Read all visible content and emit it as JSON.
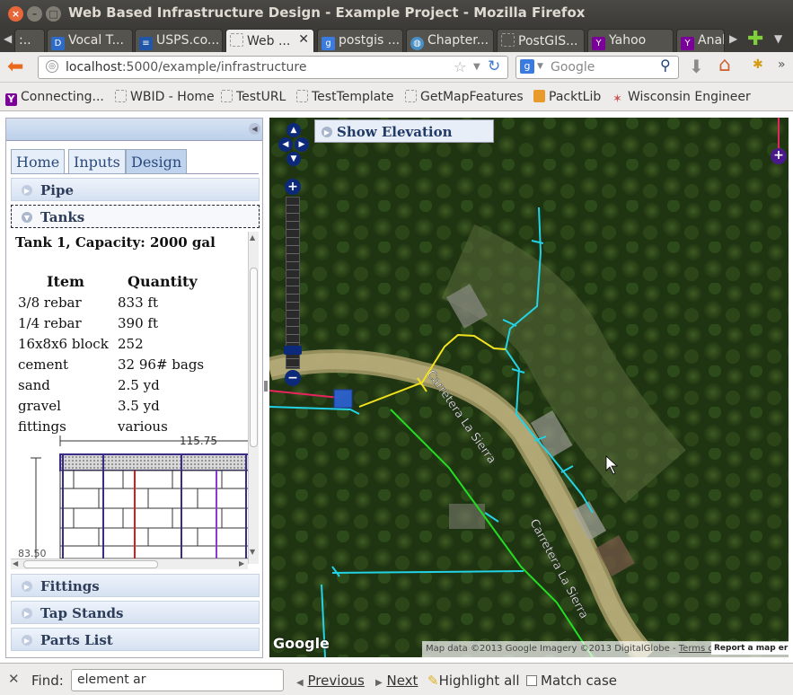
{
  "window": {
    "title": "Web Based Infrastructure Design - Example Project - Mozilla Firefox"
  },
  "tabs": [
    {
      "label": ":..",
      "icon": "page-icon"
    },
    {
      "label": "Vocal T...",
      "icon": "dl-icon"
    },
    {
      "label": "USPS.co...",
      "icon": "usps-icon"
    },
    {
      "label": "Web ...",
      "icon": "page-icon",
      "active": true
    },
    {
      "label": "postgis ...",
      "icon": "google-icon"
    },
    {
      "label": "Chapter...",
      "icon": "globe-icon"
    },
    {
      "label": "PostGIS...",
      "icon": "page-icon"
    },
    {
      "label": "Yahoo",
      "icon": "yahoo-icon"
    },
    {
      "label": "Anal",
      "icon": "yahoo-icon"
    }
  ],
  "nav": {
    "url_host": "localhost",
    "url_rest": ":5000/example/infrastructure",
    "search_placeholder": "Google"
  },
  "bookmarks": [
    {
      "label": "Connecting...",
      "icon": "yahoo-icon"
    },
    {
      "label": "WBID - Home",
      "icon": "page-icon"
    },
    {
      "label": "TestURL",
      "icon": "page-icon"
    },
    {
      "label": "TestTemplate",
      "icon": "page-icon"
    },
    {
      "label": "GetMapFeatures",
      "icon": "page-icon"
    },
    {
      "label": "PacktLib",
      "icon": "packt-icon"
    },
    {
      "label": "Wisconsin Engineer",
      "icon": "bookmark-icon"
    }
  ],
  "panel": {
    "tabs": [
      "Home",
      "Inputs",
      "Design"
    ],
    "selected_tab": "Design",
    "accordion": {
      "pipe": "Pipe",
      "tanks": "Tanks",
      "fittings": "Fittings",
      "tap_stands": "Tap Stands",
      "parts_list": "Parts List"
    },
    "tank": {
      "title": "Tank 1, Capacity: 2000 gal",
      "col_item": "Item",
      "col_qty": "Quantity",
      "rows": [
        {
          "item": "3/8 rebar",
          "qty": "833 ft"
        },
        {
          "item": "1/4 rebar",
          "qty": "390 ft"
        },
        {
          "item": "16x8x6 block",
          "qty": "252"
        },
        {
          "item": "cement",
          "qty": "32 96# bags"
        },
        {
          "item": "sand",
          "qty": "2.5 yd"
        },
        {
          "item": "gravel",
          "qty": "3.5 yd"
        },
        {
          "item": "fittings",
          "qty": "various"
        }
      ],
      "drawing_width": "115.75",
      "drawing_height": "83.50"
    }
  },
  "map": {
    "elevation_toggle": "Show Elevation",
    "road_label": "Carretera La Sierra",
    "google_logo": "Google",
    "attribution": "Map data ©2013 Google Imagery ©2013 DigitalGlobe - ",
    "terms": "Terms of Use",
    "report": "Report a map error",
    "layer_switcher": "+"
  },
  "find": {
    "label": "Find:",
    "value": "element ar",
    "previous": "Previous",
    "next": "Next",
    "highlight_all": "Highlight all",
    "match_case": "Match case"
  },
  "colors": {
    "water_pipe": "#22d3e6",
    "distribution_line": "#22dd22",
    "main_line": "#f2e21e",
    "red_line": "#e8245e",
    "tank_marker": "#2b63d9"
  }
}
